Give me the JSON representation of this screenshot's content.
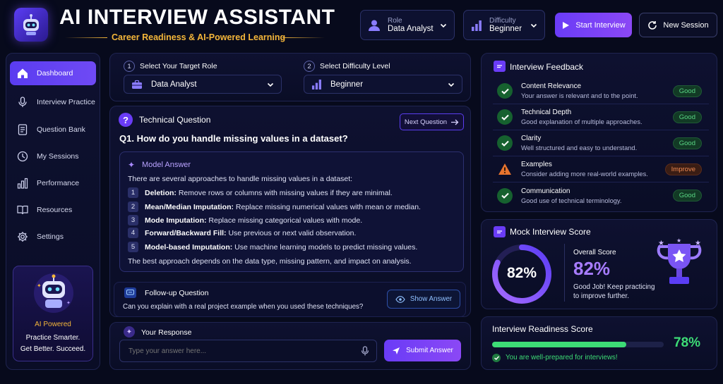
{
  "header": {
    "title": "AI INTERVIEW ASSISTANT",
    "subtitle": "Career Readiness & AI-Powered Learning",
    "role_label": "Role",
    "role_value": "Data Analyst",
    "difficulty_label": "Difficulty",
    "difficulty_value": "Beginner",
    "start_button": "Start Interview",
    "new_session_button": "New Session"
  },
  "sidebar": {
    "items": [
      {
        "label": "Dashboard",
        "icon": "home-icon",
        "active": true
      },
      {
        "label": "Interview Practice",
        "icon": "microphone-icon"
      },
      {
        "label": "Question Bank",
        "icon": "document-icon"
      },
      {
        "label": "My Sessions",
        "icon": "clock-icon"
      },
      {
        "label": "Performance",
        "icon": "bar-chart-icon"
      },
      {
        "label": "Resources",
        "icon": "book-icon"
      },
      {
        "label": "Settings",
        "icon": "gear-icon"
      }
    ],
    "promo": {
      "badge": "AI Powered",
      "line1": "Practice Smarter.",
      "line2": "Get Better. Succeed."
    }
  },
  "selectors": {
    "step1_num": "1",
    "step1_label": "Select Your Target Role",
    "step1_value": "Data Analyst",
    "step2_num": "2",
    "step2_label": "Select Difficulty Level",
    "step2_value": "Beginner"
  },
  "question": {
    "heading": "Technical Question",
    "next_button": "Next Question",
    "text": "Q1. How do you handle missing values in a dataset?"
  },
  "model_answer": {
    "heading": "Model Answer",
    "intro": "There are several approaches to handle missing values in a dataset:",
    "items": [
      {
        "num": "1",
        "title": "Deletion:",
        "text": "Remove rows or columns with missing values if they are minimal."
      },
      {
        "num": "2",
        "title": "Mean/Median Imputation:",
        "text": "Replace missing numerical values with mean or median."
      },
      {
        "num": "3",
        "title": "Mode Imputation:",
        "text": "Replace missing categorical values with mode."
      },
      {
        "num": "4",
        "title": "Forward/Backward Fill:",
        "text": "Use previous or next valid observation."
      },
      {
        "num": "5",
        "title": "Model-based Imputation:",
        "text": "Use machine learning models to predict missing values."
      }
    ],
    "conclusion": "The best approach depends on the data type, missing pattern, and impact on analysis."
  },
  "followup": {
    "heading": "Follow-up Question",
    "text": "Can you explain with a real project example when you used these techniques?",
    "show_button": "Show Answer"
  },
  "response": {
    "heading": "Your Response",
    "placeholder": "Type your answer here...",
    "submit_button": "Submit Answer"
  },
  "feedback": {
    "heading": "Interview Feedback",
    "items": [
      {
        "title": "Content Relevance",
        "desc": "Your answer is relevant and to the point.",
        "status": "Good"
      },
      {
        "title": "Technical Depth",
        "desc": "Good explanation of multiple approaches.",
        "status": "Good"
      },
      {
        "title": "Clarity",
        "desc": "Well structured and easy to understand.",
        "status": "Good"
      },
      {
        "title": "Examples",
        "desc": "Consider adding more real-world examples.",
        "status": "Improve"
      },
      {
        "title": "Communication",
        "desc": "Good use of technical terminology.",
        "status": "Good"
      }
    ]
  },
  "mock_score": {
    "heading": "Mock Interview Score",
    "percent_text": "82%",
    "value": 0.82,
    "overall_label": "Overall Score",
    "overall_value": "82%",
    "message_line1": "Good Job! Keep practicing",
    "message_line2": "to improve further."
  },
  "readiness": {
    "heading": "Interview Readiness Score",
    "value_text": "78%",
    "value": 0.78,
    "message": "You are well-prepared for interviews!"
  },
  "colors": {
    "accent": "#6a3cf7",
    "gold": "#f4b63a",
    "good": "#3ddc76",
    "warn": "#f08a52",
    "background": "#070a1c"
  }
}
